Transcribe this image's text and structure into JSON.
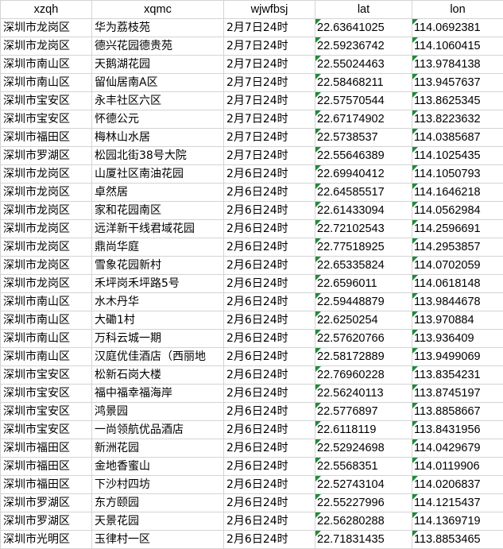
{
  "table": {
    "headers": [
      "xzqh",
      "xqmc",
      "wjwfbsj",
      "lat",
      "lon"
    ],
    "rows": [
      [
        "深圳市龙岗区",
        "华为荔枝苑",
        "2月7日24时",
        "22.63641025",
        "114.0692381"
      ],
      [
        "深圳市龙岗区",
        "德兴花园德贵苑",
        "2月7日24时",
        "22.59236742",
        "114.1060415"
      ],
      [
        "深圳市南山区",
        "天鹅湖花园",
        "2月7日24时",
        "22.55024463",
        "113.9784138"
      ],
      [
        "深圳市南山区",
        "留仙居南A区",
        "2月7日24时",
        "22.58468211",
        "113.9457637"
      ],
      [
        "深圳市宝安区",
        "永丰社区六区",
        "2月7日24时",
        "22.57570544",
        "113.8625345"
      ],
      [
        "深圳市宝安区",
        "怀德公元",
        "2月7日24时",
        "22.67174902",
        "113.8223632"
      ],
      [
        "深圳市福田区",
        "梅林山水居",
        "2月7日24时",
        "22.5738537",
        "114.0385687"
      ],
      [
        "深圳市罗湖区",
        "松园北街38号大院",
        "2月7日24时",
        "22.55646389",
        "114.1025435"
      ],
      [
        "深圳市龙岗区",
        "山厦社区南油花园",
        "2月6日24时",
        "22.69940412",
        "114.1050793"
      ],
      [
        "深圳市龙岗区",
        "卓然居",
        "2月6日24时",
        "22.64585517",
        "114.1646218"
      ],
      [
        "深圳市龙岗区",
        "家和花园南区",
        "2月6日24时",
        "22.61433094",
        "114.0562984"
      ],
      [
        "深圳市龙岗区",
        "远洋新干线君域花园",
        "2月6日24时",
        "22.72102543",
        "114.2596691"
      ],
      [
        "深圳市龙岗区",
        "鼎尚华庭",
        "2月6日24时",
        "22.77518925",
        "114.2953857"
      ],
      [
        "深圳市龙岗区",
        "雪象花园新村",
        "2月6日24时",
        "22.65335824",
        "114.0702059"
      ],
      [
        "深圳市龙岗区",
        "禾坪岗禾坪路5号",
        "2月6日24时",
        "22.6596011",
        "114.0618148"
      ],
      [
        "深圳市南山区",
        "水木丹华",
        "2月6日24时",
        "22.59448879",
        "113.9844678"
      ],
      [
        "深圳市南山区",
        "大磡1村",
        "2月6日24时",
        "22.6250254",
        "113.970884"
      ],
      [
        "深圳市南山区",
        "万科云城一期",
        "2月6日24时",
        "22.57620766",
        "113.936409"
      ],
      [
        "深圳市南山区",
        "汉庭优佳酒店（西丽地",
        "2月6日24时",
        "22.58172889",
        "113.9499069"
      ],
      [
        "深圳市宝安区",
        "松新石岗大楼",
        "2月6日24时",
        "22.76960228",
        "113.8354231"
      ],
      [
        "深圳市宝安区",
        "福中福幸福海岸",
        "2月6日24时",
        "22.56240113",
        "113.8745197"
      ],
      [
        "深圳市宝安区",
        "鸿景园",
        "2月6日24时",
        "22.5776897",
        "113.8858667"
      ],
      [
        "深圳市宝安区",
        "一尚领航优品酒店",
        "2月6日24时",
        "22.6118119",
        "113.8431956"
      ],
      [
        "深圳市福田区",
        "新洲花园",
        "2月6日24时",
        "22.52924698",
        "114.0429679"
      ],
      [
        "深圳市福田区",
        "金地香蜜山",
        "2月6日24时",
        "22.5568351",
        "114.0119906"
      ],
      [
        "深圳市福田区",
        "下沙村四坊",
        "2月6日24时",
        "22.52743104",
        "114.0206837"
      ],
      [
        "深圳市罗湖区",
        "东方颐园",
        "2月6日24时",
        "22.55227996",
        "114.1215437"
      ],
      [
        "深圳市罗湖区",
        "天景花园",
        "2月6日24时",
        "22.56280288",
        "114.1369719"
      ],
      [
        "深圳市光明区",
        "玉律村一区",
        "2月6日24时",
        "22.71831435",
        "113.8853465"
      ]
    ]
  },
  "colors": {
    "gridline": "#d4d4d4",
    "number_stored_as_text_flag": "#1e8b3a"
  }
}
